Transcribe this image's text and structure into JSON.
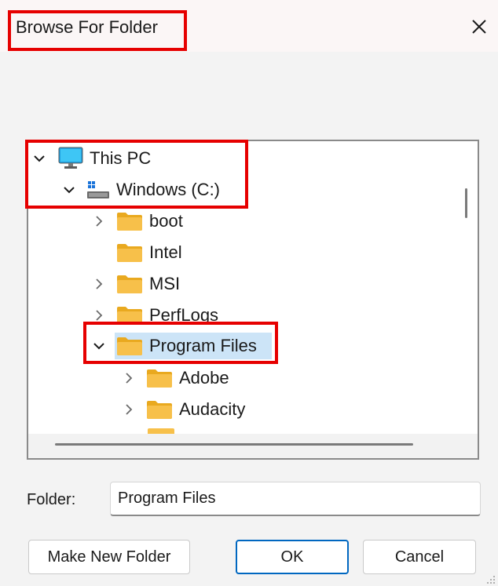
{
  "window": {
    "title": "Browse For Folder",
    "close_glyph": "✕"
  },
  "tree": {
    "nodes": [
      {
        "label": "This PC",
        "icon": "monitor-icon",
        "state": "expanded"
      },
      {
        "label": "Windows (C:)",
        "icon": "drive-icon",
        "state": "expanded"
      },
      {
        "label": "boot",
        "icon": "folder-icon",
        "state": "collapsed"
      },
      {
        "label": "Intel",
        "icon": "folder-icon",
        "state": "leaf"
      },
      {
        "label": "MSI",
        "icon": "folder-icon",
        "state": "collapsed"
      },
      {
        "label": "PerfLogs",
        "icon": "folder-icon",
        "state": "collapsed"
      },
      {
        "label": "Program Files",
        "icon": "folder-icon",
        "state": "expanded",
        "selected": true
      },
      {
        "label": "Adobe",
        "icon": "folder-icon",
        "state": "collapsed"
      },
      {
        "label": "Audacity",
        "icon": "folder-icon",
        "state": "collapsed"
      }
    ]
  },
  "folder_field": {
    "label": "Folder:",
    "value": "Program Files"
  },
  "buttons": {
    "make_new_folder": "Make New Folder",
    "ok": "OK",
    "cancel": "Cancel"
  },
  "colors": {
    "highlight_box": "#e60000",
    "selection": "#cce4f7",
    "folder": "#f7c04a",
    "accent": "#0067c0"
  }
}
